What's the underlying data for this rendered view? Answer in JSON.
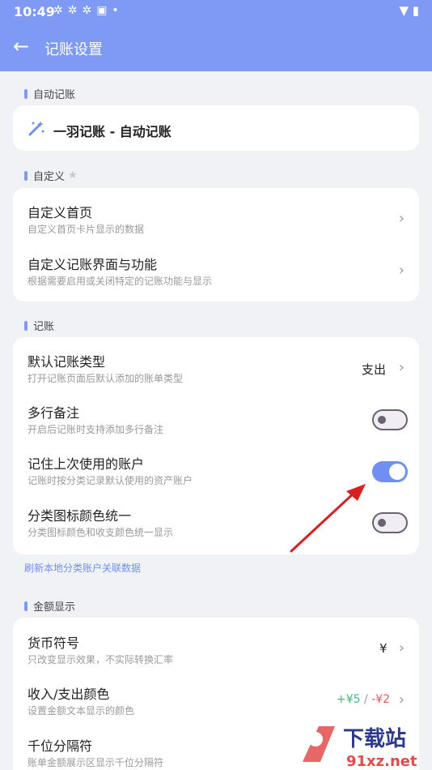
{
  "status_bar": {
    "time": "10:49",
    "icons": [
      "notification-icon",
      "notification-icon",
      "notification-icon",
      "image-icon",
      "dot-icon"
    ],
    "right": "wifi-icon battery-icon"
  },
  "app_bar": {
    "back_icon": "arrow-left-icon",
    "title": "记账设置"
  },
  "sections": {
    "auto": {
      "label": "自动记账",
      "item_title": "一羽记账 - 自动记账",
      "icon": "magic-wand-icon"
    },
    "custom": {
      "label": "自定义",
      "items": [
        {
          "title": "自定义首页",
          "subtitle": "自定义首页卡片显示的数据"
        },
        {
          "title": "自定义记账界面与功能",
          "subtitle": "根据需要启用或关闭特定的记账功能与显示"
        }
      ]
    },
    "bookkeeping": {
      "label": "记账",
      "items": [
        {
          "title": "默认记账类型",
          "subtitle": "打开记账页面后默认添加的账单类型",
          "value": "支出"
        },
        {
          "title": "多行备注",
          "subtitle": "开启后记账时支持添加多行备注",
          "toggle": false
        },
        {
          "title": "记住上次使用的账户",
          "subtitle": "记账时按分类记录默认使用的资产账户",
          "toggle": true
        },
        {
          "title": "分类图标颜色统一",
          "subtitle": "分类图标颜色和收支颜色统一显示",
          "toggle": false
        }
      ],
      "refresh_link": "刷新本地分类账户关联数据"
    },
    "amount": {
      "label": "金额显示",
      "items": [
        {
          "title": "货币符号",
          "subtitle": "只改变显示效果，不实际转换汇率",
          "value": "¥"
        },
        {
          "title": "收入/支出颜色",
          "subtitle": "设置金额文本显示的颜色",
          "income": "+¥5",
          "sep": " / ",
          "expense": "-¥2"
        },
        {
          "title": "千位分隔符",
          "subtitle": "账单金额展示区显示千位分隔符"
        }
      ]
    }
  },
  "colors": {
    "accent": "#7e9af4",
    "income": "#3dba78",
    "expense": "#e8575a",
    "annotation_arrow": "#d92020"
  },
  "watermark": {
    "text": "下载站",
    "url_text": "91xz.net"
  }
}
